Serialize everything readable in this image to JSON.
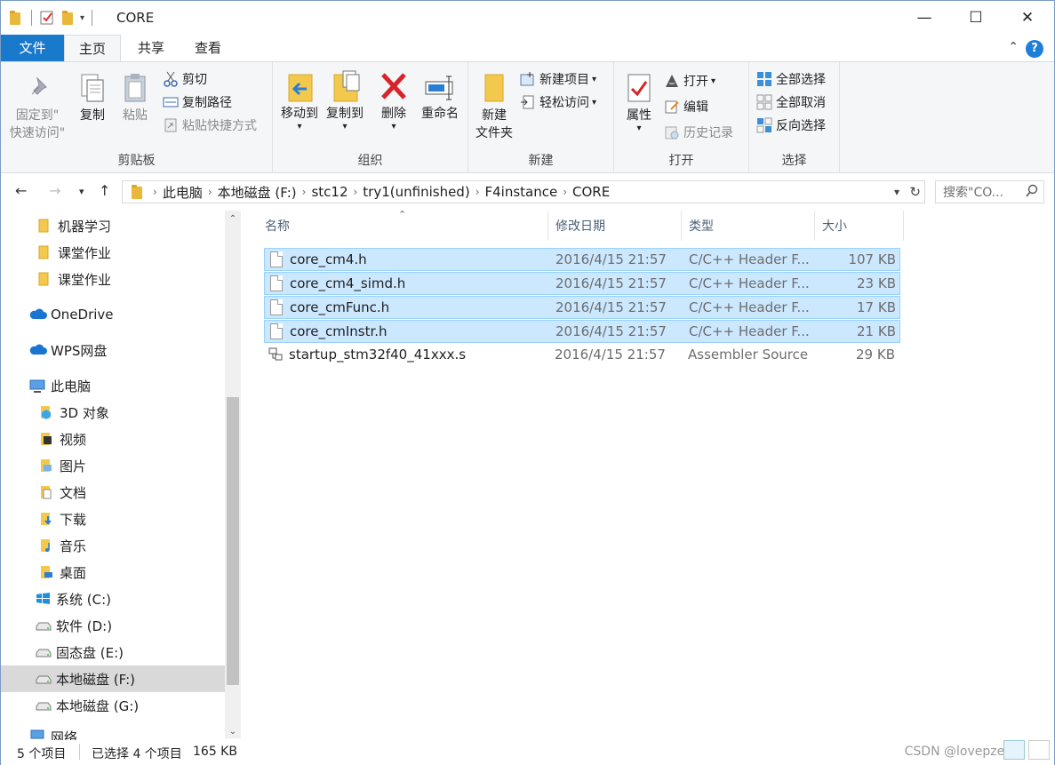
{
  "window": {
    "title": "CORE",
    "minimize": "—",
    "maximize": "☐",
    "close": "✕"
  },
  "tabs": [
    {
      "label": "文件"
    },
    {
      "label": "主页"
    },
    {
      "label": "共享"
    },
    {
      "label": "查看"
    }
  ],
  "ribbon": {
    "clipboard": {
      "label": "剪贴板",
      "pin": "固定到\"\n快速访问\"",
      "pin_l1": "固定到\"",
      "pin_l2": "快速访问\"",
      "copy": "复制",
      "paste": "粘贴",
      "cut": "剪切",
      "copy_path": "复制路径",
      "paste_shortcut": "粘贴快捷方式"
    },
    "organize": {
      "label": "组织",
      "move_to": "移动到",
      "copy_to": "复制到",
      "delete": "删除",
      "rename": "重命名"
    },
    "new": {
      "label": "新建",
      "new_folder_l1": "新建",
      "new_folder_l2": "文件夹",
      "new_item": "新建项目",
      "easy_access": "轻松访问"
    },
    "open": {
      "label": "打开",
      "properties": "属性",
      "open": "打开",
      "edit": "编辑",
      "history": "历史记录"
    },
    "select": {
      "label": "选择",
      "select_all": "全部选择",
      "select_none": "全部取消",
      "invert": "反向选择"
    }
  },
  "address": {
    "crumbs": [
      "此电脑",
      "本地磁盘 (F:)",
      "stc12",
      "try1(unfinished)",
      "F4instance",
      "CORE"
    ],
    "search_placeholder": "搜索\"CO..."
  },
  "nav": [
    {
      "label": "机器学习",
      "icon": "folder-icon"
    },
    {
      "label": "课堂作业",
      "icon": "folder-icon"
    },
    {
      "label": "课堂作业",
      "icon": "folder-icon"
    },
    {
      "label": "OneDrive",
      "icon": "cloud-icon"
    },
    {
      "label": "WPS网盘",
      "icon": "cloud-icon"
    },
    {
      "label": "此电脑",
      "icon": "computer-icon"
    },
    {
      "label": "3D 对象",
      "icon": "3d-objects-icon"
    },
    {
      "label": "视频",
      "icon": "video-icon"
    },
    {
      "label": "图片",
      "icon": "pictures-icon"
    },
    {
      "label": "文档",
      "icon": "documents-icon"
    },
    {
      "label": "下载",
      "icon": "download-icon"
    },
    {
      "label": "音乐",
      "icon": "music-icon"
    },
    {
      "label": "桌面",
      "icon": "desktop-icon"
    },
    {
      "label": "系统 (C:)",
      "icon": "windows-drive-icon"
    },
    {
      "label": "软件 (D:)",
      "icon": "drive-icon"
    },
    {
      "label": "固态盘 (E:)",
      "icon": "drive-icon"
    },
    {
      "label": "本地磁盘 (F:)",
      "icon": "drive-icon"
    },
    {
      "label": "本地磁盘 (G:)",
      "icon": "drive-icon"
    },
    {
      "label": "网络",
      "icon": "network-icon"
    }
  ],
  "columns": {
    "name": "名称",
    "date": "修改日期",
    "type": "类型",
    "size": "大小"
  },
  "files": [
    {
      "name": "core_cm4.h",
      "date": "2016/4/15 21:57",
      "type": "C/C++ Header F...",
      "size": "107 KB",
      "selected": true
    },
    {
      "name": "core_cm4_simd.h",
      "date": "2016/4/15 21:57",
      "type": "C/C++ Header F...",
      "size": "23 KB",
      "selected": true
    },
    {
      "name": "core_cmFunc.h",
      "date": "2016/4/15 21:57",
      "type": "C/C++ Header F...",
      "size": "17 KB",
      "selected": true
    },
    {
      "name": "core_cmInstr.h",
      "date": "2016/4/15 21:57",
      "type": "C/C++ Header F...",
      "size": "21 KB",
      "selected": true
    },
    {
      "name": "startup_stm32f40_41xxx.s",
      "date": "2016/4/15 21:57",
      "type": "Assembler Source",
      "size": "29 KB",
      "selected": false
    }
  ],
  "status": {
    "count": "5 个项目",
    "selected": "已选择 4 个项目",
    "size": "165 KB",
    "watermark": "CSDN @lovepzeroll"
  }
}
